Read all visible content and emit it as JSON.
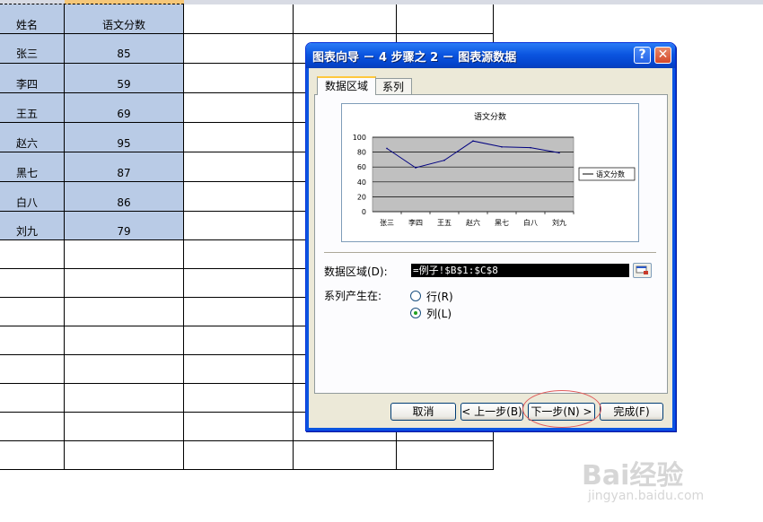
{
  "sheet": {
    "header_names": [
      "姓名",
      "语文分数"
    ],
    "rows": [
      {
        "name": "张三",
        "score": "85"
      },
      {
        "name": "李四",
        "score": "59"
      },
      {
        "name": "王五",
        "score": "69"
      },
      {
        "name": "赵六",
        "score": "95"
      },
      {
        "name": "黑七",
        "score": "87"
      },
      {
        "name": "白八",
        "score": "86"
      },
      {
        "name": "刘九",
        "score": "79"
      }
    ]
  },
  "dialog": {
    "title": "图表向导 － 4 步骤之 2 － 图表源数据",
    "help_symbol": "?",
    "close_symbol": "✕",
    "tabs": [
      "数据区域",
      "系列"
    ],
    "data_range_label": "数据区域(D):",
    "data_range_value": "=例子!$B$1:$C$8",
    "series_in_label": "系列产生在:",
    "radio_rows_label": "行(R)",
    "radio_cols_label": "列(L)",
    "selected_series_in": "列(L)",
    "buttons": {
      "cancel": "取消",
      "back": "< 上一步(B)",
      "next": "下一步(N) >",
      "finish": "完成(F)"
    }
  },
  "chart_data": {
    "type": "line",
    "title": "语文分数",
    "categories": [
      "张三",
      "李四",
      "王五",
      "赵六",
      "黑七",
      "白八",
      "刘九"
    ],
    "series": [
      {
        "name": "语文分数",
        "values": [
          85,
          59,
          69,
          95,
          87,
          86,
          79
        ]
      }
    ],
    "ylim": [
      0,
      100
    ],
    "yticks": [
      0,
      20,
      40,
      60,
      80,
      100
    ],
    "grid": true,
    "legend": "right",
    "plot_background": "#c0c0c0",
    "line_color": "#000080"
  },
  "watermark": {
    "brand": "Bai经验",
    "url": "jingyan.baidu.com"
  }
}
